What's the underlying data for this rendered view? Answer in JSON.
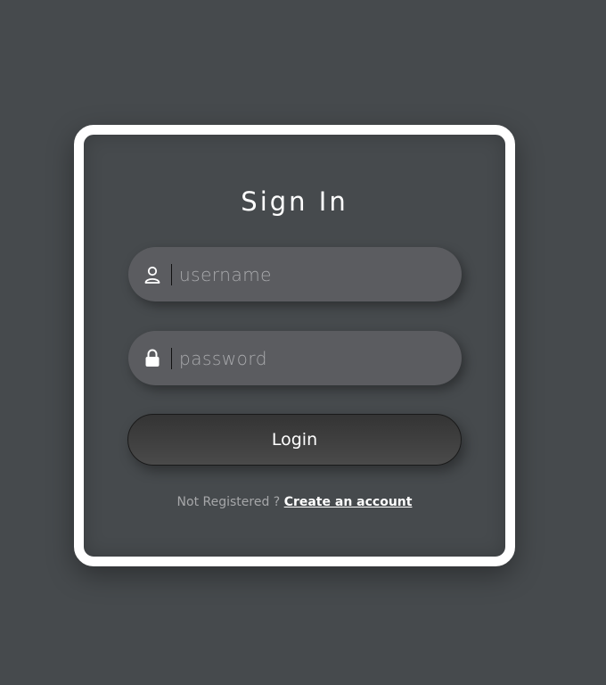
{
  "form": {
    "title": "Sign In",
    "username": {
      "placeholder": "username",
      "value": "",
      "icon": "user-icon"
    },
    "password": {
      "placeholder": "password",
      "value": "",
      "icon": "lock-icon"
    },
    "login_label": "Login",
    "register_prompt": "Not Registered ?",
    "register_link": "Create an account"
  },
  "colors": {
    "background": "#464a4d",
    "card_border": "#ffffff",
    "field_bg": "#5b5c60",
    "button_bg": "#3b3b3b",
    "muted_text": "#a6a7a9"
  }
}
